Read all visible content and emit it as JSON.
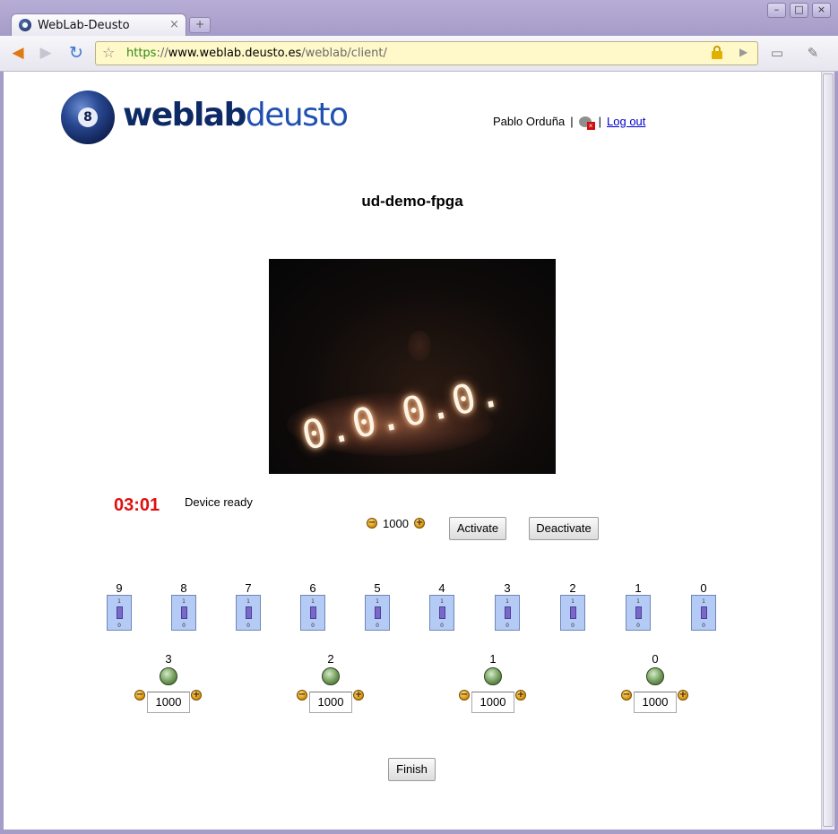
{
  "browser": {
    "tab_title": "WebLab-Deusto",
    "tab_close": "×",
    "new_tab": "+",
    "url_scheme": "https",
    "url_sep": "://",
    "url_host": "www.weblab.deusto.es",
    "url_path": "/weblab/client/",
    "window_buttons": [
      "–",
      "□",
      "×"
    ]
  },
  "header": {
    "logo_text_bold": "weblab",
    "logo_text_light": "deusto",
    "logo_ball_number": "8",
    "user_name": "Pablo Orduña",
    "separator": "|",
    "logout": "Log out"
  },
  "experiment": {
    "title": "ud-demo-fpga",
    "camera_display": "0.0.0.0.",
    "timer": "03:01",
    "status": "Device ready",
    "clock": {
      "value": "1000",
      "minus": "−",
      "plus": "+"
    },
    "activate_label": "Activate",
    "deactivate_label": "Deactivate",
    "switch_on": "1",
    "switch_off": "0",
    "switches": [
      "9",
      "8",
      "7",
      "6",
      "5",
      "4",
      "3",
      "2",
      "1",
      "0"
    ],
    "leds": [
      {
        "label": "3",
        "value": "1000"
      },
      {
        "label": "2",
        "value": "1000"
      },
      {
        "label": "1",
        "value": "1000"
      },
      {
        "label": "0",
        "value": "1000"
      }
    ],
    "finish_label": "Finish"
  },
  "colors": {
    "timer": "#e01010",
    "link": "#0000cc",
    "switch_fill": "#b4ccf5",
    "led_fill": "#6f9a58"
  }
}
